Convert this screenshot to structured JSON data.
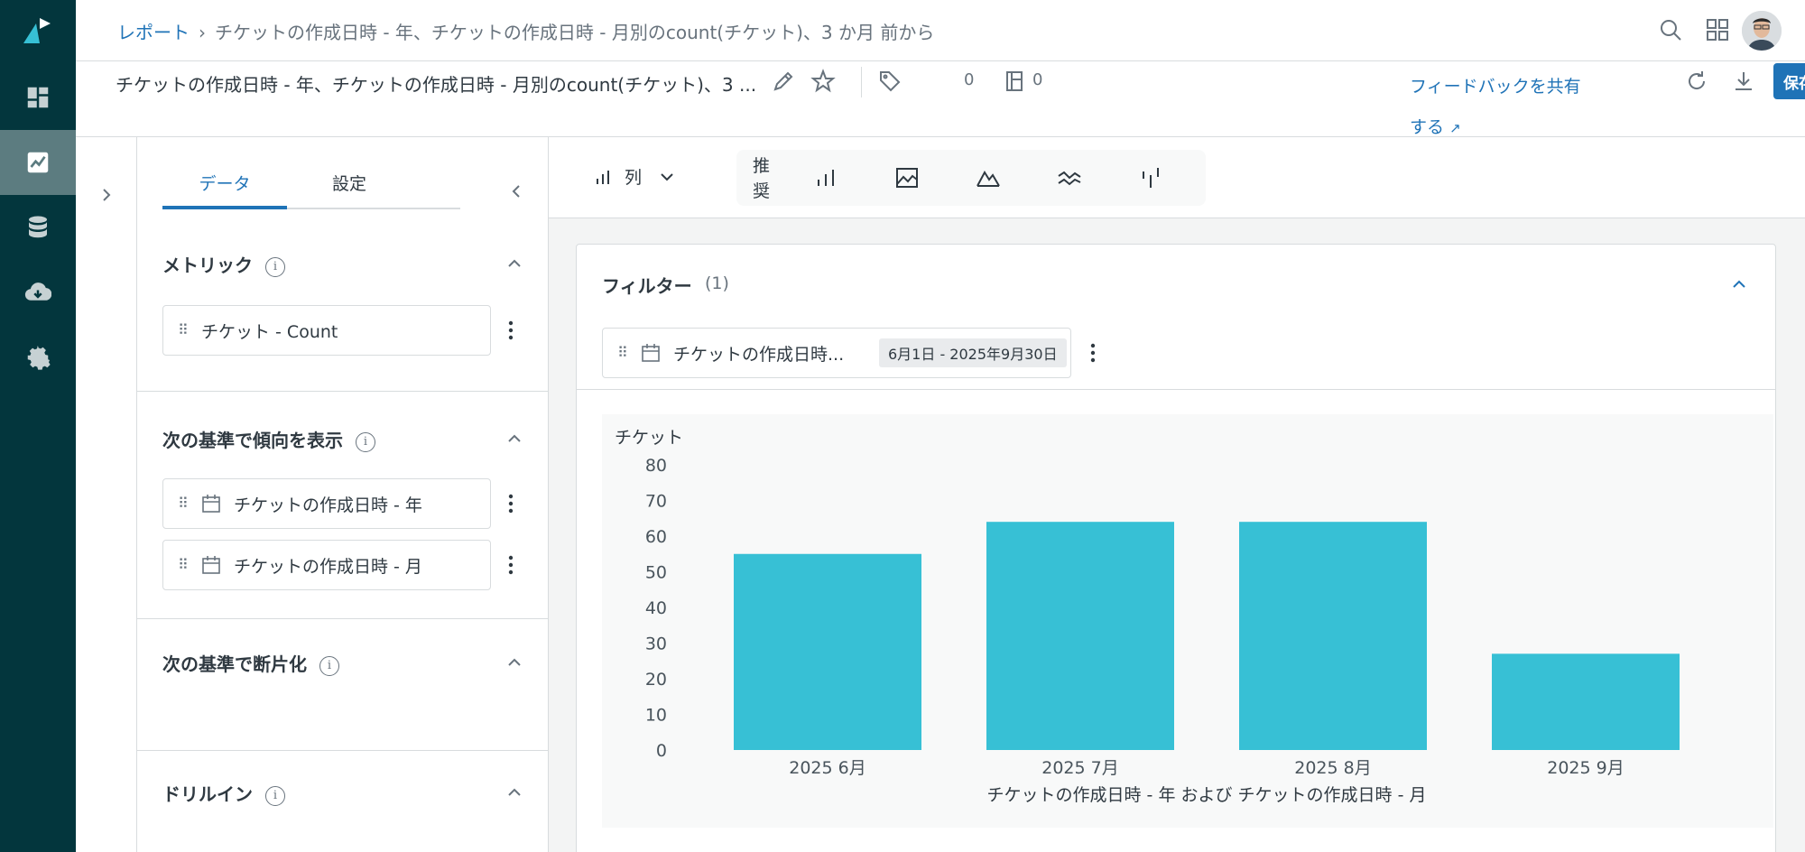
{
  "nav": {
    "items": [
      "dashboard-icon",
      "reports-icon",
      "database-icon",
      "download-icon",
      "settings-icon"
    ],
    "active": "reports-icon",
    "rail_color": "#03363d"
  },
  "breadcrumb": {
    "root": "レポート",
    "current": "チケットの作成日時 - 年、チケットの作成日時 - 月別のcount(チケット)、3 か月 前から"
  },
  "report": {
    "title": "チケットの作成日時 - 年、チケットの作成日時 - 月別のcount(チケット)、3 ...",
    "tag_count": "0",
    "doc_count": "0",
    "feedback_label": "フィードバックを共有する",
    "save_label": "保存"
  },
  "panel": {
    "tabs": [
      "データ",
      "設定"
    ],
    "active_tab": "データ",
    "metrics_title": "メトリック",
    "metrics": [
      "チケット - Count"
    ],
    "trend_title": "次の基準で傾向を表示",
    "trend_items": [
      "チケットの作成日時 - 年",
      "チケットの作成日時 - 月"
    ],
    "slice_title": "次の基準で断片化",
    "drill_title": "ドリルイン"
  },
  "chart_type": {
    "selected_label": "列",
    "suggest_label": "推奨",
    "options": [
      "column-chart-icon",
      "area-image-icon",
      "mountain-chart-icon",
      "sparkline-icon",
      "candle-chart-icon"
    ]
  },
  "filter": {
    "title": "フィルター",
    "count": "(1)",
    "item_label": "チケットの作成日時...",
    "item_value": "6月1日 - 2025年9月30日"
  },
  "chart_data": {
    "type": "bar",
    "ylabel": "チケット",
    "xlabel": "チケットの作成日時 - 年 および チケットの作成日時 - 月",
    "categories": [
      "2025 6月",
      "2025 7月",
      "2025 8月",
      "2025 9月"
    ],
    "values": [
      55,
      64,
      64,
      27
    ],
    "ylim": [
      0,
      80
    ],
    "yticks": [
      0,
      10,
      20,
      30,
      40,
      50,
      60,
      70,
      80
    ],
    "bar_color": "#37c0d5",
    "grid": false
  }
}
